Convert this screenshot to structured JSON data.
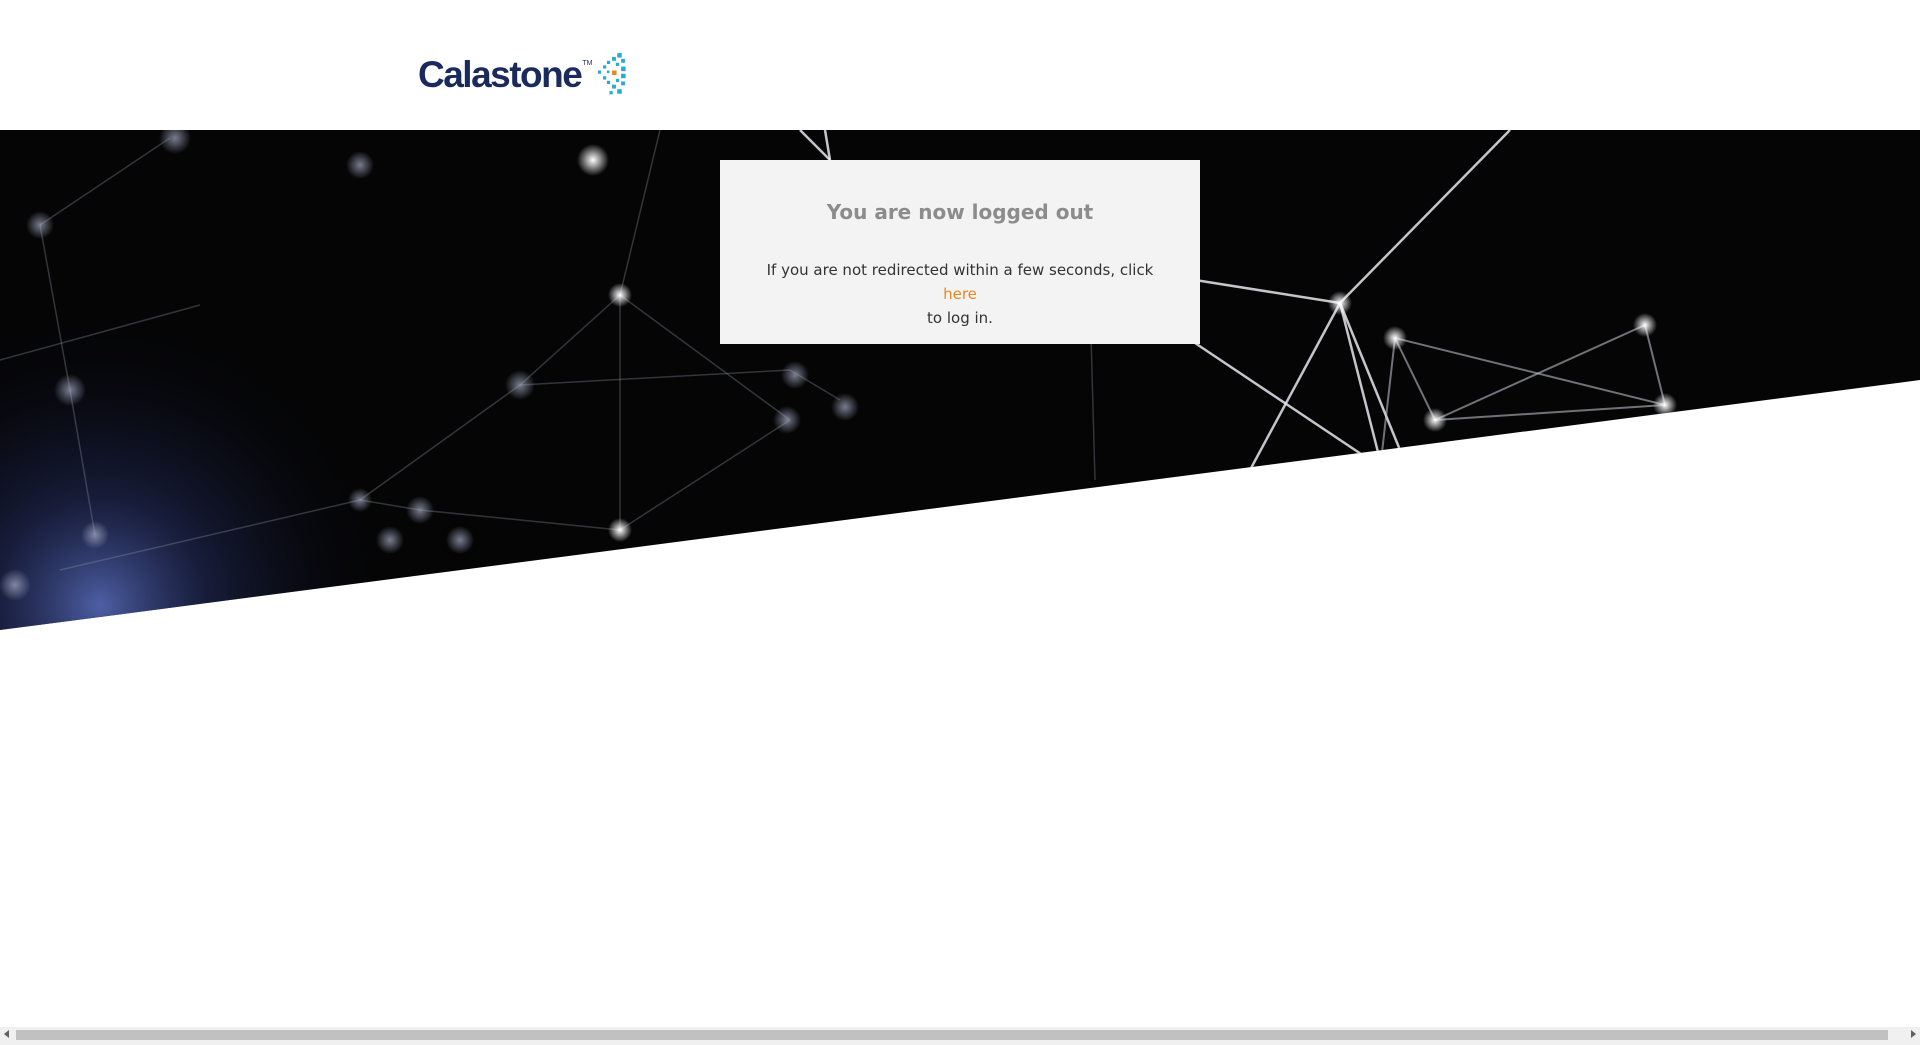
{
  "header": {
    "logo_text": "Calastone",
    "logo_tm": "TM",
    "logo_mark_icon": "calastone-cube-mark-icon",
    "brand_color": "#1b2a5c",
    "mark_color": "#2aa8d8",
    "mark_accent_color": "#e8891d"
  },
  "logout": {
    "title": "You are now logged out",
    "message_before": "If you are not redirected within a few seconds, click",
    "link_text": "here",
    "message_after": "to log in.",
    "link_color": "#e8891d"
  },
  "scrollbar": {
    "left_icon": "scroll-left-arrow-icon",
    "right_icon": "scroll-right-arrow-icon"
  }
}
